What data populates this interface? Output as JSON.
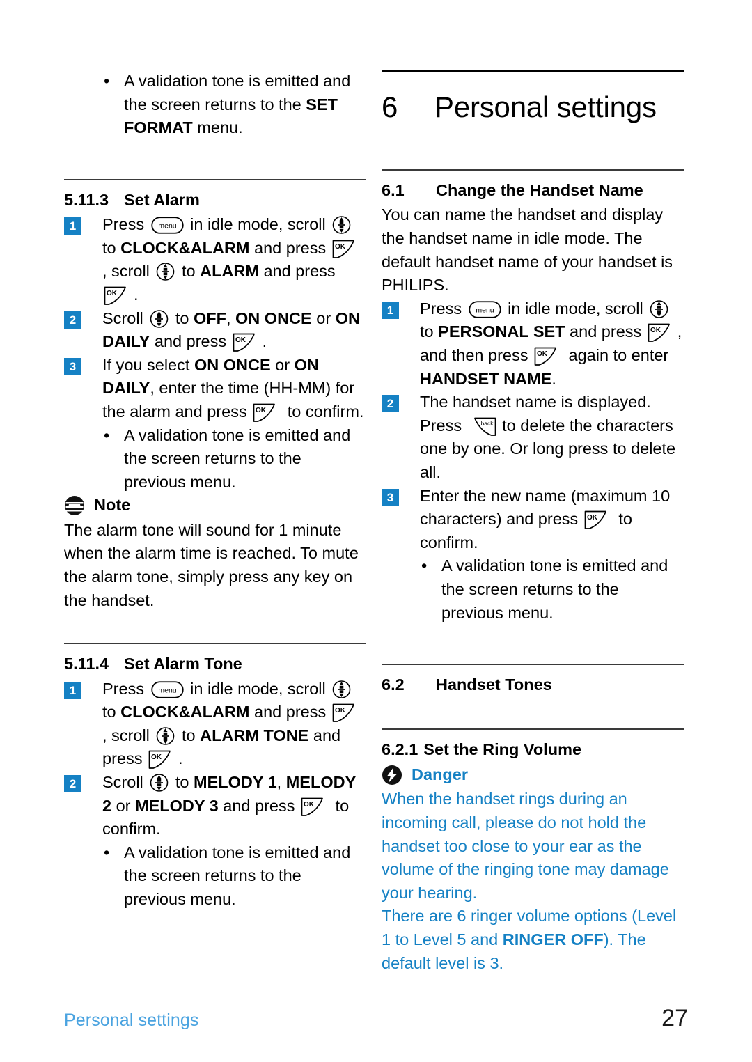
{
  "page": {
    "number": "27",
    "footer_label": "Personal settings",
    "accent_blue": "#1581c4",
    "footer_blue": "#4aa3e0"
  },
  "chapter": {
    "number": "6",
    "title": "Personal settings"
  },
  "left_column": {
    "top_bullet": {
      "marker": "•",
      "text_a": "A validation tone is emitted and the screen returns to the ",
      "bold_b": "SET FORMAT",
      "text_c": " menu."
    },
    "section_alarm": {
      "number": "5.11.3",
      "title": "Set Alarm",
      "steps": [
        {
          "badge": "1",
          "p1": "Press ",
          "icon1": "menu-key-icon",
          "p2": " in idle mode, scroll ",
          "icon2": "scroll-key-icon",
          "p3": " to ",
          "bold1": "CLOCK&ALARM",
          "p4": " and press ",
          "icon3": "ok-key-icon",
          "p5": ", scroll ",
          "icon4": "scroll-key-icon",
          "p6": " to ",
          "bold2": "ALARM",
          "p7": " and press ",
          "icon5": "ok-key-icon",
          "p8": "."
        },
        {
          "badge": "2",
          "p1": "Scroll ",
          "icon1": "scroll-key-icon",
          "p2": " to ",
          "bold1": "OFF",
          "p3": ", ",
          "bold2": "ON ONCE",
          "p4": " or ",
          "bold3": "ON DAILY",
          "p5": " and press ",
          "icon2": "ok-key-icon",
          "p6": "."
        },
        {
          "badge": "3",
          "p1": "If you select ",
          "bold1": "ON ONCE",
          "p2": " or ",
          "bold2": "ON DAILY",
          "p3": ", enter the time (HH-MM) for the alarm and press ",
          "icon1": "ok-key-icon",
          "p4": " to confirm."
        }
      ],
      "bullet": {
        "marker": "•",
        "text": "A validation tone is emitted and the screen returns to the previous menu."
      }
    },
    "note": {
      "icon": "note-icon",
      "label": "Note",
      "text": "The alarm tone will sound for 1 minute when the alarm time is reached. To mute the alarm tone, simply press any key on the handset."
    },
    "section_alarm_tone": {
      "number": "5.11.4",
      "title": "Set Alarm Tone",
      "steps": [
        {
          "badge": "1",
          "p1": "Press ",
          "icon1": "menu-key-icon",
          "p2": " in idle mode, scroll ",
          "icon2": "scroll-key-icon",
          "p3": " to ",
          "bold1": "CLOCK&ALARM",
          "p4": " and press ",
          "icon3": "ok-key-icon",
          "p5": ", scroll ",
          "icon4": "scroll-key-icon",
          "p6": " to ",
          "bold2": "ALARM TONE",
          "p7": " and press ",
          "icon5": "ok-key-icon",
          "p8": "."
        },
        {
          "badge": "2",
          "p1": "Scroll ",
          "icon1": "scroll-key-icon",
          "p2": " to ",
          "bold1": "MELODY 1",
          "p3": ", ",
          "bold2": "MELODY 2",
          "p4": " or ",
          "bold3": "MELODY 3",
          "p5": " and press ",
          "icon2": "ok-key-icon",
          "p6": " to confirm."
        }
      ],
      "bullet": {
        "marker": "•",
        "text": "A validation tone is emitted and the screen returns to the previous menu."
      }
    }
  },
  "right_column": {
    "section_handset_name": {
      "number": "6.1",
      "title": "Change the Handset Name",
      "intro": "You can name the handset and display the handset name in idle mode. The default handset name of your handset is PHILIPS.",
      "steps": [
        {
          "badge": "1",
          "p1": "Press ",
          "icon1": "menu-key-icon",
          "p2": " in idle mode, scroll ",
          "icon2": "scroll-key-icon",
          "p3": " to ",
          "bold1": "PERSONAL SET",
          "p4": " and press ",
          "icon3": "ok-key-icon",
          "p5": ", and then press ",
          "icon4": "ok-key-icon",
          "p6": " again to enter ",
          "bold2": "HANDSET NAME",
          "p7": "."
        },
        {
          "badge": "2",
          "p1": "The handset name is displayed. Press ",
          "icon1": "back-key-icon",
          "p2": " to delete the characters one by one. Or long press to delete all."
        },
        {
          "badge": "3",
          "p1": "Enter the new name (maximum 10 characters) and press ",
          "icon1": "ok-key-icon",
          "p2": " to confirm."
        }
      ],
      "bullet": {
        "marker": "•",
        "text": "A validation tone is emitted and the screen returns to the previous menu."
      }
    },
    "section_handset_tones": {
      "number": "6.2",
      "title": "Handset Tones"
    },
    "section_ring_volume": {
      "number": "6.2.1",
      "title": "Set the Ring Volume",
      "danger": {
        "icon": "danger-icon",
        "label": "Danger",
        "para1": "When the handset rings during an incoming call, please do not hold the handset too close to your ear as the volume of the ringing tone may damage your hearing.",
        "para2_a": "There are 6 ringer volume options (Level 1 to Level 5 and ",
        "para2_bold": "RINGER OFF",
        "para2_c": "). The default level is 3."
      }
    }
  }
}
